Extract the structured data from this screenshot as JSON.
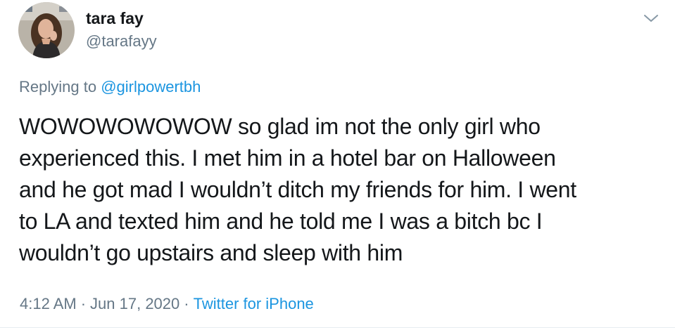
{
  "user": {
    "display_name": "tara fay",
    "handle": "@tarafayy"
  },
  "reply": {
    "prefix": "Replying to ",
    "mention": "@girlpowertbh"
  },
  "tweet": {
    "lines": [
      "WOWOWOWOWOW so glad im not the only girl who",
      "experienced this. I met him in a hotel bar on Halloween",
      "and he got mad I wouldn’t ditch my friends for him. I went",
      "to LA and texted him and he told me I was a bitch bc I",
      "wouldn’t go upstairs and sleep with him"
    ]
  },
  "meta": {
    "time": "4:12 AM",
    "separator": "·",
    "date": "Jun 17, 2020",
    "source": "Twitter for iPhone"
  },
  "icons": {
    "menu": "chevron-down-icon",
    "avatar": "profile-photo"
  },
  "colors": {
    "text": "#14171a",
    "secondary": "#657786",
    "link": "#1b95e0"
  }
}
